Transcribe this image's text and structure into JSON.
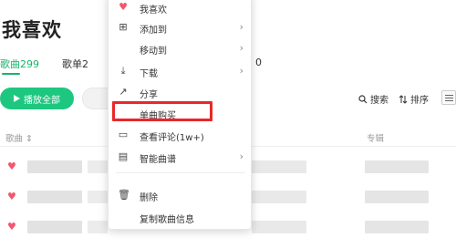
{
  "page": {
    "title": "我喜欢"
  },
  "tabs": [
    {
      "label": "歌曲",
      "count": "299"
    },
    {
      "label": "歌单",
      "count": "2"
    },
    {
      "label": "",
      "count": "0"
    }
  ],
  "actions": {
    "play_all": "播放全部",
    "search": "搜索",
    "sort": "排序"
  },
  "columns": {
    "song": "歌曲",
    "album": "专辑"
  },
  "rows_count": 3,
  "context_menu": {
    "items": [
      {
        "label": "我喜欢",
        "icon": "heart-icon",
        "submenu": false
      },
      {
        "label": "添加到",
        "icon": "plus-box-icon",
        "submenu": true
      },
      {
        "label": "移动到",
        "icon": "",
        "submenu": true
      },
      {
        "label": "下载",
        "icon": "download-icon",
        "submenu": true
      },
      {
        "label": "分享",
        "icon": "share-icon",
        "submenu": false
      },
      {
        "label": "单曲购买",
        "icon": "",
        "submenu": false
      },
      {
        "label": "查看评论(1w+)",
        "icon": "comment-icon",
        "submenu": false
      },
      {
        "label": "智能曲谱",
        "icon": "sheet-icon",
        "submenu": true
      },
      {
        "label": "删除",
        "icon": "trash-icon",
        "submenu": false
      },
      {
        "label": "复制歌曲信息",
        "icon": "",
        "submenu": false
      }
    ],
    "highlighted": "单曲购买"
  },
  "colors": {
    "accent": "#1ec77f",
    "heart": "#f2576d",
    "highlight_box": "#e8282a"
  }
}
